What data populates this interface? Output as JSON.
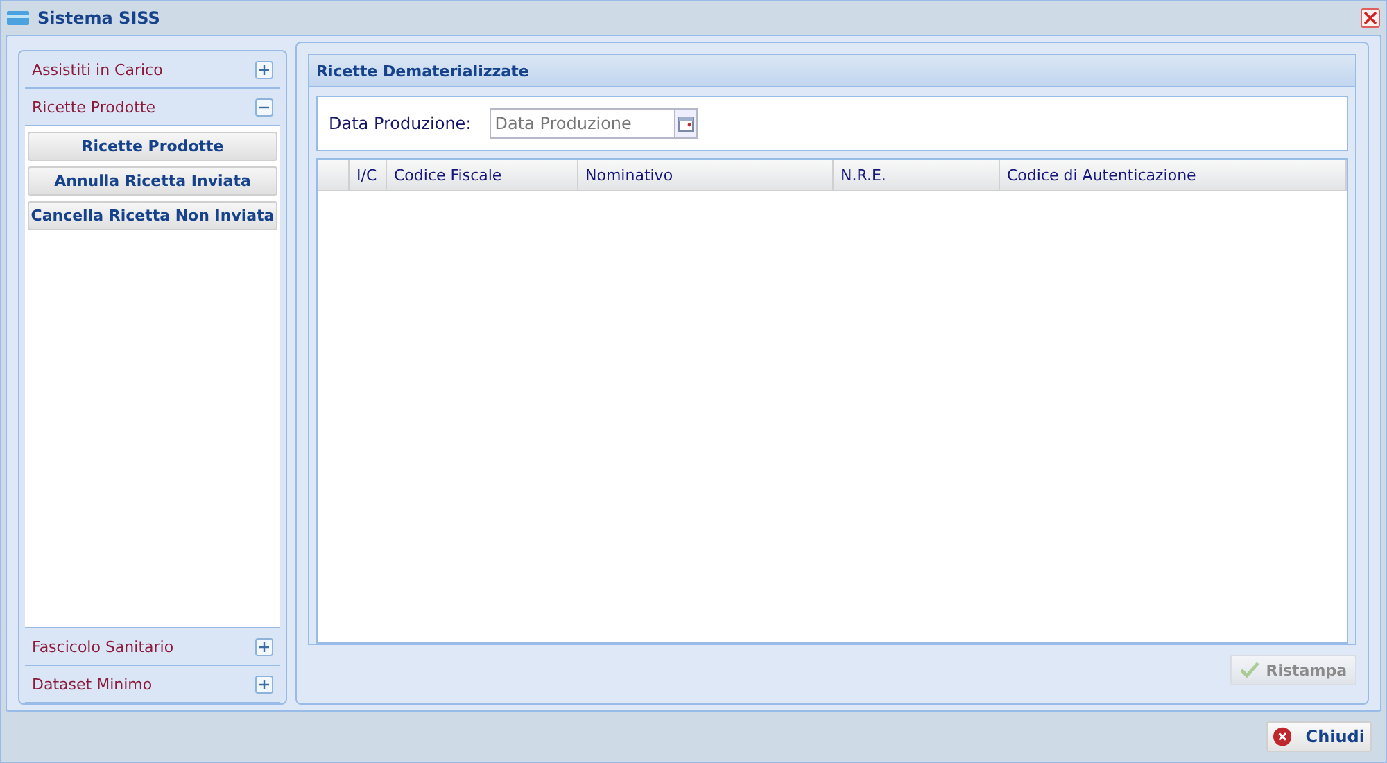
{
  "window": {
    "title": "Sistema SISS"
  },
  "sidebar": {
    "sections": [
      {
        "label": "Assistiti in Carico",
        "expanded": false
      },
      {
        "label": "Ricette Prodotte",
        "expanded": true,
        "items": [
          "Ricette Prodotte",
          "Annulla Ricetta Inviata",
          "Cancella Ricetta Non Inviata"
        ]
      },
      {
        "label": "Fascicolo Sanitario",
        "expanded": false
      },
      {
        "label": "Dataset Minimo",
        "expanded": false
      }
    ]
  },
  "panel": {
    "title": "Ricette Dematerializzate",
    "date_field": {
      "label": "Data Produzione:",
      "placeholder": "Data Produzione"
    },
    "table": {
      "columns": [
        "I/C",
        "Codice Fiscale",
        "Nominativo",
        "N.R.E.",
        "Codice di Autenticazione"
      ]
    },
    "buttons": [
      {
        "label": "Ristampa",
        "disabled": true
      }
    ]
  },
  "footer": {
    "buttons": [
      {
        "label": "Chiudi"
      }
    ]
  }
}
